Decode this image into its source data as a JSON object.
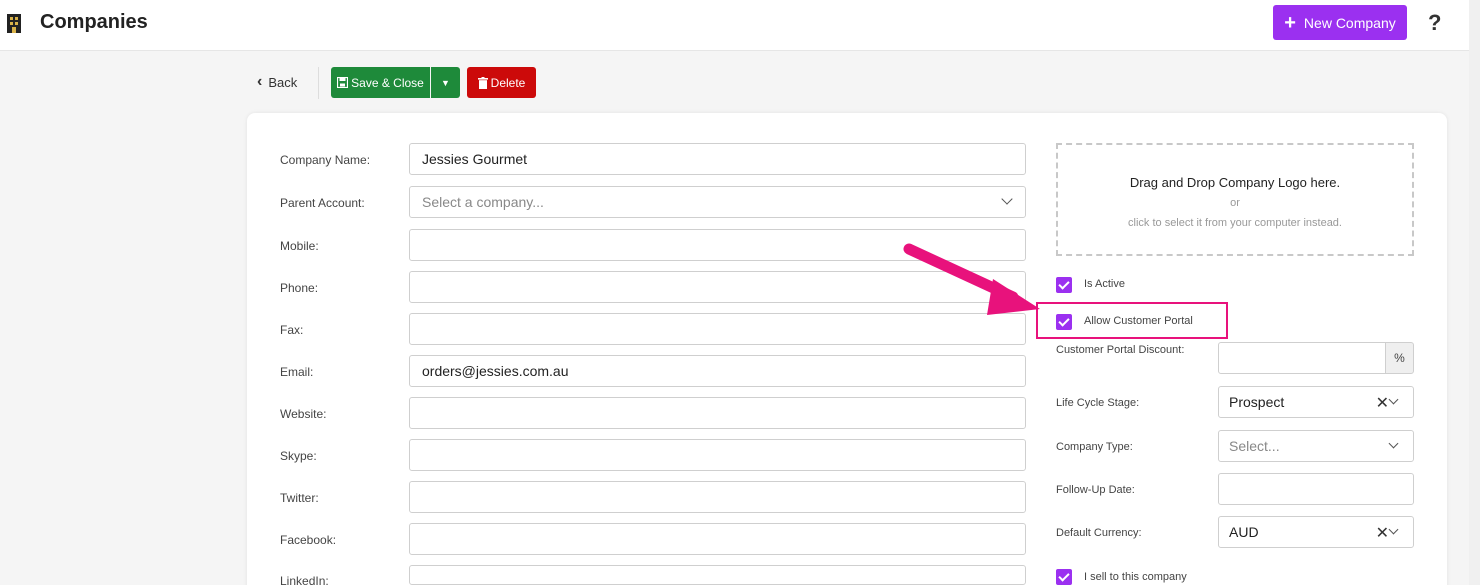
{
  "header": {
    "title": "Companies",
    "new_button_label": "New Company",
    "help_label": "?"
  },
  "toolbar": {
    "back_label": "Back",
    "save_label": "Save & Close",
    "delete_label": "Delete"
  },
  "form": {
    "company_name": {
      "label": "Company Name:",
      "value": "Jessies Gourmet"
    },
    "parent_account": {
      "label": "Parent Account:",
      "placeholder": "Select a company..."
    },
    "mobile": {
      "label": "Mobile:",
      "value": ""
    },
    "phone": {
      "label": "Phone:",
      "value": ""
    },
    "fax": {
      "label": "Fax:",
      "value": ""
    },
    "email": {
      "label": "Email:",
      "value": "orders@jessies.com.au"
    },
    "website": {
      "label": "Website:",
      "value": ""
    },
    "skype": {
      "label": "Skype:",
      "value": ""
    },
    "twitter": {
      "label": "Twitter:",
      "value": ""
    },
    "facebook": {
      "label": "Facebook:",
      "value": ""
    },
    "linkedin": {
      "label": "LinkedIn:",
      "value": ""
    }
  },
  "logo_dropzone": {
    "title": "Drag and Drop Company Logo here.",
    "or": "or",
    "subtitle": "click to select it from your computer instead."
  },
  "options": {
    "is_active": {
      "label": "Is Active",
      "checked": true
    },
    "allow_customer_portal": {
      "label": "Allow Customer Portal",
      "checked": true
    },
    "customer_portal_discount": {
      "label": "Customer Portal Discount:",
      "value": "",
      "unit": "%"
    },
    "life_cycle_stage": {
      "label": "Life Cycle Stage:",
      "value": "Prospect"
    },
    "company_type": {
      "label": "Company Type:",
      "placeholder": "Select..."
    },
    "follow_up_date": {
      "label": "Follow-Up Date:",
      "value": ""
    },
    "default_currency": {
      "label": "Default Currency:",
      "value": "AUD"
    },
    "i_sell": {
      "label": "I sell to this company",
      "checked": true
    }
  },
  "colors": {
    "accent": "#9b30f0",
    "save": "#1e8a3a",
    "delete": "#cc0a0a",
    "annotation": "#e8127c"
  }
}
